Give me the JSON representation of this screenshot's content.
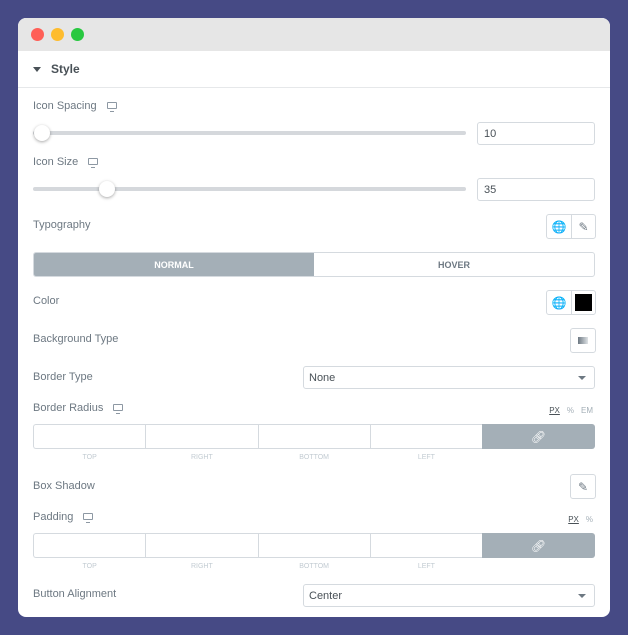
{
  "window": {
    "controls": [
      {
        "name": "close",
        "color": "#ff5f57"
      },
      {
        "name": "minimize",
        "color": "#febc2e"
      },
      {
        "name": "maximize",
        "color": "#28c840"
      }
    ]
  },
  "section": {
    "title": "Style"
  },
  "icon_spacing": {
    "label": "Icon Spacing",
    "value": "10",
    "level": 0.02
  },
  "icon_size": {
    "label": "Icon Size",
    "value": "35",
    "level": 0.17
  },
  "typography": {
    "label": "Typography"
  },
  "tabs": [
    {
      "label": "NORMAL",
      "active": true
    },
    {
      "label": "HOVER",
      "active": false
    }
  ],
  "color": {
    "label": "Color",
    "swatch": "#000000"
  },
  "background_type": {
    "label": "Background Type"
  },
  "border_type": {
    "label": "Border Type",
    "value": "None"
  },
  "border_radius": {
    "label": "Border Radius",
    "units": [
      "PX",
      "%",
      "EM"
    ],
    "fields": [
      "TOP",
      "RIGHT",
      "BOTTOM",
      "LEFT"
    ]
  },
  "box_shadow": {
    "label": "Box Shadow"
  },
  "padding": {
    "label": "Padding",
    "units": [
      "PX",
      "%"
    ],
    "fields": [
      "TOP",
      "RIGHT",
      "BOTTOM",
      "LEFT"
    ]
  },
  "button_alignment": {
    "label": "Button Alignment",
    "value": "Center"
  }
}
